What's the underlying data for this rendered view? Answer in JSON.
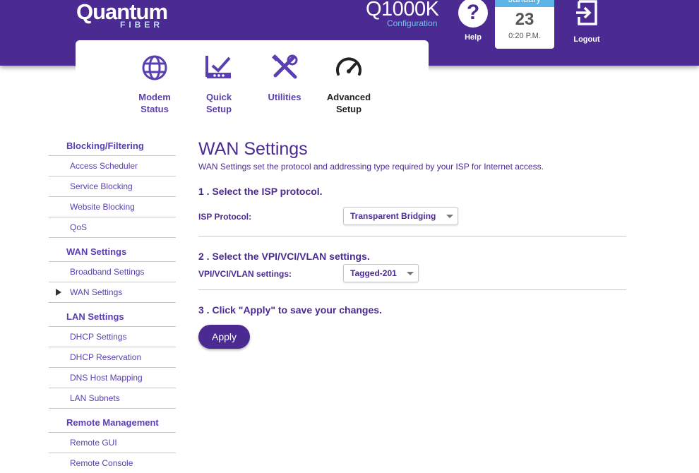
{
  "header": {
    "logo_main": "Quantum",
    "logo_sub": "FIBER",
    "model": "Q1000K",
    "config_label": "Configuration",
    "help_label": "Help",
    "date": {
      "month": "January",
      "day": "23",
      "time": "0:20 P.M."
    },
    "logout_label": "Logout"
  },
  "nav": {
    "items": [
      {
        "label1": "Modem",
        "label2": "Status",
        "icon": "globe-icon"
      },
      {
        "label1": "Quick",
        "label2": "Setup",
        "icon": "router-check-icon"
      },
      {
        "label1": "Utilities",
        "label2": "",
        "icon": "tools-icon"
      },
      {
        "label1": "Advanced",
        "label2": "Setup",
        "icon": "gauge-icon",
        "active": true
      }
    ]
  },
  "sidebar": {
    "sections": [
      {
        "title": "Blocking/Filtering",
        "items": [
          "Access Scheduler",
          "Service Blocking",
          "Website Blocking",
          "QoS"
        ]
      },
      {
        "title": "WAN Settings",
        "items": [
          "Broadband Settings",
          "WAN Settings"
        ]
      },
      {
        "title": "LAN Settings",
        "items": [
          "DHCP Settings",
          "DHCP Reservation",
          "DNS Host Mapping",
          "LAN Subnets"
        ]
      },
      {
        "title": "Remote Management",
        "items": [
          "Remote GUI",
          "Remote Console"
        ]
      }
    ],
    "selected": "WAN Settings"
  },
  "main": {
    "title": "WAN Settings",
    "description": "WAN Settings set the protocol and addressing type required by your ISP for Internet access.",
    "step1": "1 . Select the ISP protocol.",
    "isp_label": "ISP Protocol:",
    "isp_value": "Transparent Bridging",
    "step2": "2 . Select the VPI/VCI/VLAN settings.",
    "vpi_label": "VPI/VCI/VLAN settings:",
    "vpi_value": "Tagged-201",
    "step3": "3 . Click \"Apply\" to save your changes.",
    "apply_label": "Apply"
  },
  "colors": {
    "brand": "#4b2b92",
    "accent": "#5ab4e8",
    "link": "#5a3fb0"
  }
}
